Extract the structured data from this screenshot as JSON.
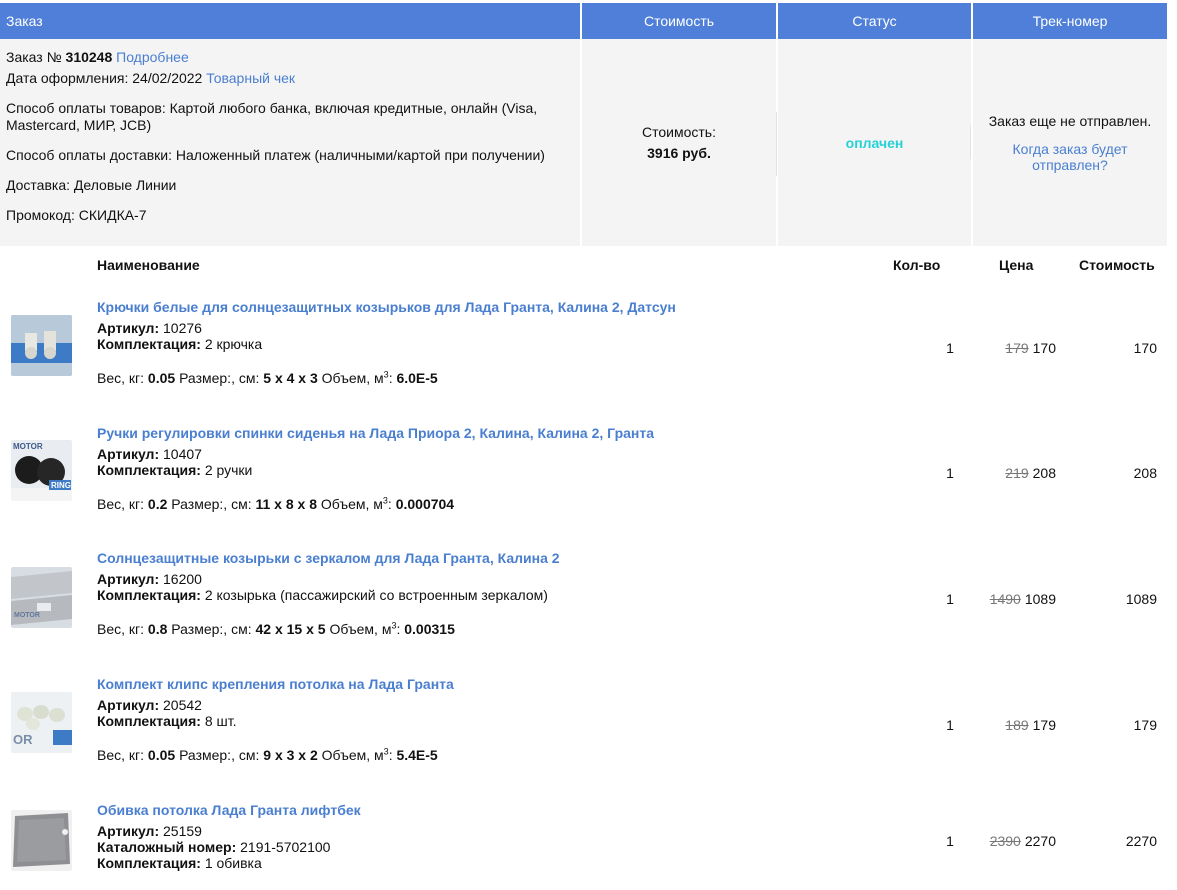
{
  "header": {
    "order": "Заказ",
    "cost": "Стоимость",
    "status": "Статус",
    "track": "Трек-номер"
  },
  "order": {
    "number_prefix": "Заказ №",
    "number": "310248",
    "details_link": "Подробнее",
    "date_label": "Дата оформления:",
    "date": "24/02/2022",
    "receipt_link": "Товарный чек",
    "payment_goods": "Способ оплаты товаров: Картой любого банка, включая кредитные, онлайн (Visa, Mastercard, МИР, JCB)",
    "payment_delivery": "Способ оплаты доставки: Наложенный платеж (наличными/картой при получении)",
    "delivery": "Доставка: Деловые Линии",
    "promo": "Промокод: СКИДКА-7"
  },
  "cost": {
    "label": "Стоимость:",
    "value": "3916 руб."
  },
  "status": {
    "value": "оплачен",
    "color": "#25d0d6"
  },
  "track": {
    "note": "Заказ еще не отправлен.",
    "link": "Когда заказ будет отправлен?"
  },
  "table": {
    "col_name": "Наименование",
    "col_qty": "Кол-во",
    "col_price": "Цена",
    "col_sum": "Стоимость"
  },
  "labels": {
    "article": "Артикул:",
    "catalog": "Каталожный номер:",
    "kit": "Комплектация:",
    "weight": "Вес, кг:",
    "size": "Размер:, см:",
    "volume": "Объем, м"
  },
  "items": [
    {
      "name": "Крючки белые для солнцезащитных козырьков для Лада Гранта, Калина 2, Датсун",
      "article": "10276",
      "kit": "2 крючка",
      "weight": "0.05",
      "size": "5 x 4 x 3",
      "volume": "6.0E-5",
      "qty": "1",
      "old_price": "179",
      "price": "170",
      "sum": "170"
    },
    {
      "name": "Ручки регулировки спинки сиденья на Лада Приора 2, Калина, Калина 2, Гранта",
      "article": "10407",
      "kit": "2 ручки",
      "weight": "0.2",
      "size": "11 x 8 x 8",
      "volume": "0.000704",
      "qty": "1",
      "old_price": "219",
      "price": "208",
      "sum": "208"
    },
    {
      "name": "Солнцезащитные козырьки с зеркалом для Лада Гранта, Калина 2",
      "article": "16200",
      "kit": "2 козырька (пассажирский со встроенным зеркалом)",
      "weight": "0.8",
      "size": "42 x 15 x 5",
      "volume": "0.00315",
      "qty": "1",
      "old_price": "1490",
      "price": "1089",
      "sum": "1089"
    },
    {
      "name": "Комплект клипс крепления потолка на Лада Гранта",
      "article": "20542",
      "kit": "8 шт.",
      "weight": "0.05",
      "size": "9 x 3 x 2",
      "volume": "5.4E-5",
      "qty": "1",
      "old_price": "189",
      "price": "179",
      "sum": "179"
    },
    {
      "name": "Обивка потолка Лада Гранта лифтбек",
      "article": "25159",
      "catalog": "2191-5702100",
      "kit": "1 обивка",
      "qty": "1",
      "old_price": "2390",
      "price": "2270",
      "sum": "2270"
    }
  ],
  "thumb_text": {
    "motor": "MOTOR",
    "ring": "RING",
    "or": "OR"
  }
}
